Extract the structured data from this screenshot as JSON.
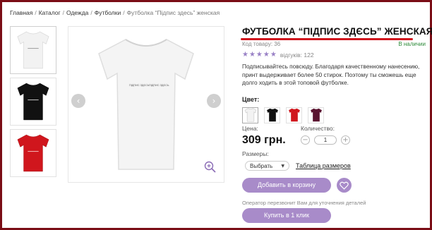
{
  "breadcrumb": {
    "items": [
      "Главная",
      "Каталог",
      "Одежда",
      "Футболки"
    ],
    "current": "Футболка “Підпис здесь” женская",
    "separator": "/"
  },
  "product": {
    "title": "ФУТБОЛКА “ПІДПИС ЗДЄСЬ” ЖЕНСКАЯ",
    "code_label": "Код товару: 36",
    "stock": "В наличии",
    "stars": "★★★★★",
    "reviews": "відгуків: 122",
    "description": "Подписывайтесь повсюду. Благодаря качественному нанесению, принт выдерживает более 50 стирок. Поэтому ты сможешь еще долго ходить в этой топовой футболке.",
    "print_text": "ПІДПИС ЗДЄСЬ"
  },
  "colors": {
    "label": "Цвет:",
    "swatches": [
      {
        "name": "white",
        "hex": "#f2f2f2"
      },
      {
        "name": "black",
        "hex": "#111111"
      },
      {
        "name": "red",
        "hex": "#d0161d"
      },
      {
        "name": "burgundy",
        "hex": "#5a1430"
      }
    ]
  },
  "price": {
    "label": "Цена:",
    "value": "309 грн."
  },
  "quantity": {
    "label": "Количество:",
    "value": "1",
    "minus": "−",
    "plus": "+"
  },
  "sizes": {
    "label": "Размеры:",
    "selected": "Выбрать",
    "table_link": "Таблица размеров"
  },
  "buttons": {
    "add_to_cart": "Добавить в корзину",
    "callback_note": "Оператор перезвонит Вам для уточнения деталей",
    "buy_one_click": "Купить в 1 клик"
  },
  "gallery": {
    "prev": "‹",
    "next": "›"
  },
  "theme": {
    "accent": "#a88bc9",
    "frame": "#7a0d16",
    "mark": "#d0161d"
  }
}
